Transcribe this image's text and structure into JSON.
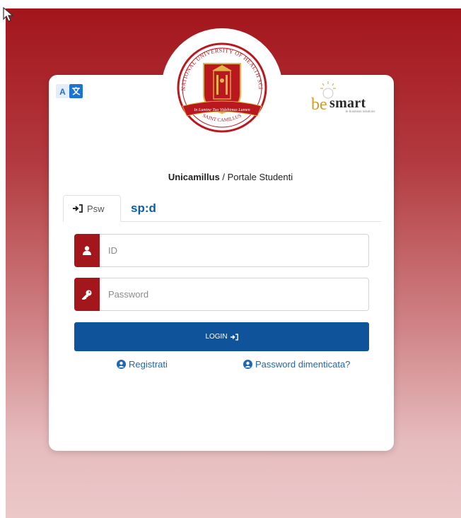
{
  "brand": {
    "seal_text_top": "INTERNATIONAL UNIVERSITY OF HEALTH SCIENCES",
    "seal_text_bottom": "SAINT CAMILLUS",
    "seal_motto": "In Lumine Tuo Videbimus Lumen",
    "partner_be": "be",
    "partner_smart": "smart",
    "partner_tagline": "le business solutions"
  },
  "title": {
    "org": "Unicamillus",
    "separator": " / ",
    "portal": "Portale Studenti"
  },
  "tabs": {
    "psw_label": "Psw",
    "spid_label": "sp:d"
  },
  "form": {
    "id_placeholder": "ID",
    "password_placeholder": "Password",
    "login_label": "LOGIN"
  },
  "links": {
    "register": "Registrati",
    "forgot": "Password dimenticata?"
  },
  "colors": {
    "primary_red": "#a3171c",
    "login_blue": "#0f539b",
    "link_blue": "#1f66b3"
  },
  "icons": [
    "translate-icon",
    "user-icon",
    "key-icon",
    "sign-in-icon",
    "user-circle-icon"
  ]
}
